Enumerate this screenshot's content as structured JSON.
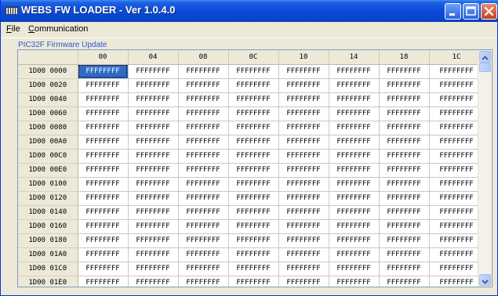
{
  "window": {
    "title": "WEBS FW LOADER - Ver 1.0.4.0"
  },
  "menu": {
    "file": {
      "mnemonic": "F",
      "rest": "ile"
    },
    "communication": {
      "mnemonic": "C",
      "rest": "ommunication"
    }
  },
  "group": {
    "label": "PIC32F Firmware Update"
  },
  "grid": {
    "columns": [
      "00",
      "04",
      "08",
      "0C",
      "10",
      "14",
      "18",
      "1C"
    ],
    "rows": [
      {
        "address": "1D00 0000",
        "cells": [
          "FFFFFFFF",
          "FFFFFFFF",
          "FFFFFFFF",
          "FFFFFFFF",
          "FFFFFFFF",
          "FFFFFFFF",
          "FFFFFFFF",
          "FFFFFFFF"
        ]
      },
      {
        "address": "1D00 0020",
        "cells": [
          "FFFFFFFF",
          "FFFFFFFF",
          "FFFFFFFF",
          "FFFFFFFF",
          "FFFFFFFF",
          "FFFFFFFF",
          "FFFFFFFF",
          "FFFFFFFF"
        ]
      },
      {
        "address": "1D00 0040",
        "cells": [
          "FFFFFFFF",
          "FFFFFFFF",
          "FFFFFFFF",
          "FFFFFFFF",
          "FFFFFFFF",
          "FFFFFFFF",
          "FFFFFFFF",
          "FFFFFFFF"
        ]
      },
      {
        "address": "1D00 0060",
        "cells": [
          "FFFFFFFF",
          "FFFFFFFF",
          "FFFFFFFF",
          "FFFFFFFF",
          "FFFFFFFF",
          "FFFFFFFF",
          "FFFFFFFF",
          "FFFFFFFF"
        ]
      },
      {
        "address": "1D00 0080",
        "cells": [
          "FFFFFFFF",
          "FFFFFFFF",
          "FFFFFFFF",
          "FFFFFFFF",
          "FFFFFFFF",
          "FFFFFFFF",
          "FFFFFFFF",
          "FFFFFFFF"
        ]
      },
      {
        "address": "1D00 00A0",
        "cells": [
          "FFFFFFFF",
          "FFFFFFFF",
          "FFFFFFFF",
          "FFFFFFFF",
          "FFFFFFFF",
          "FFFFFFFF",
          "FFFFFFFF",
          "FFFFFFFF"
        ]
      },
      {
        "address": "1D00 00C0",
        "cells": [
          "FFFFFFFF",
          "FFFFFFFF",
          "FFFFFFFF",
          "FFFFFFFF",
          "FFFFFFFF",
          "FFFFFFFF",
          "FFFFFFFF",
          "FFFFFFFF"
        ]
      },
      {
        "address": "1D00 00E0",
        "cells": [
          "FFFFFFFF",
          "FFFFFFFF",
          "FFFFFFFF",
          "FFFFFFFF",
          "FFFFFFFF",
          "FFFFFFFF",
          "FFFFFFFF",
          "FFFFFFFF"
        ]
      },
      {
        "address": "1D00 0100",
        "cells": [
          "FFFFFFFF",
          "FFFFFFFF",
          "FFFFFFFF",
          "FFFFFFFF",
          "FFFFFFFF",
          "FFFFFFFF",
          "FFFFFFFF",
          "FFFFFFFF"
        ]
      },
      {
        "address": "1D00 0120",
        "cells": [
          "FFFFFFFF",
          "FFFFFFFF",
          "FFFFFFFF",
          "FFFFFFFF",
          "FFFFFFFF",
          "FFFFFFFF",
          "FFFFFFFF",
          "FFFFFFFF"
        ]
      },
      {
        "address": "1D00 0140",
        "cells": [
          "FFFFFFFF",
          "FFFFFFFF",
          "FFFFFFFF",
          "FFFFFFFF",
          "FFFFFFFF",
          "FFFFFFFF",
          "FFFFFFFF",
          "FFFFFFFF"
        ]
      },
      {
        "address": "1D00 0160",
        "cells": [
          "FFFFFFFF",
          "FFFFFFFF",
          "FFFFFFFF",
          "FFFFFFFF",
          "FFFFFFFF",
          "FFFFFFFF",
          "FFFFFFFF",
          "FFFFFFFF"
        ]
      },
      {
        "address": "1D00 0180",
        "cells": [
          "FFFFFFFF",
          "FFFFFFFF",
          "FFFFFFFF",
          "FFFFFFFF",
          "FFFFFFFF",
          "FFFFFFFF",
          "FFFFFFFF",
          "FFFFFFFF"
        ]
      },
      {
        "address": "1D00 01A0",
        "cells": [
          "FFFFFFFF",
          "FFFFFFFF",
          "FFFFFFFF",
          "FFFFFFFF",
          "FFFFFFFF",
          "FFFFFFFF",
          "FFFFFFFF",
          "FFFFFFFF"
        ]
      },
      {
        "address": "1D00 01C0",
        "cells": [
          "FFFFFFFF",
          "FFFFFFFF",
          "FFFFFFFF",
          "FFFFFFFF",
          "FFFFFFFF",
          "FFFFFFFF",
          "FFFFFFFF",
          "FFFFFFFF"
        ]
      },
      {
        "address": "1D00 01E0",
        "cells": [
          "FFFFFFFF",
          "FFFFFFFF",
          "FFFFFFFF",
          "FFFFFFFF",
          "FFFFFFFF",
          "FFFFFFFF",
          "FFFFFFFF",
          "FFFFFFFF"
        ]
      }
    ],
    "selected_cell": {
      "row": 0,
      "col": 0
    }
  },
  "icons": {
    "app": "app-icon",
    "minimize": "minimize-icon",
    "maximize": "maximize-icon",
    "close": "close-icon",
    "scroll_up": "chevron-up-icon",
    "scroll_down": "chevron-down-icon"
  },
  "colors": {
    "titlebar": "#0a4ad8",
    "selection": "#316ac5",
    "group_label": "#2c5ad0",
    "close_button": "#c6401c"
  }
}
